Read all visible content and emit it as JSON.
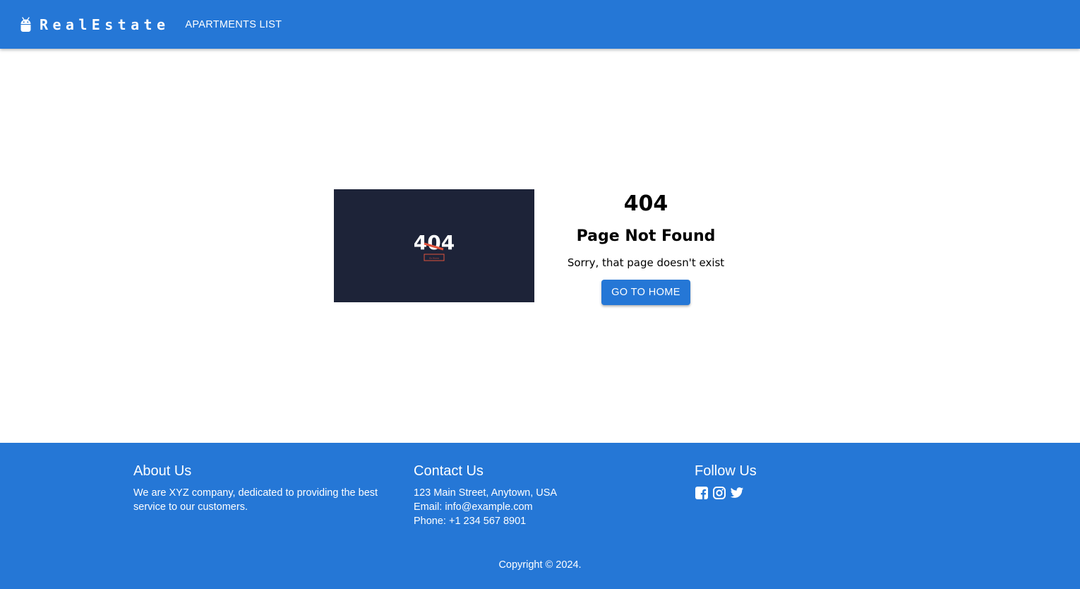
{
  "header": {
    "brand": "RealEstate",
    "logo_icon": "android-icon",
    "nav": [
      {
        "label": "APARTMENTS LIST"
      }
    ]
  },
  "hero_image": {
    "code": "404",
    "caption": "Go Home"
  },
  "error": {
    "code": "404",
    "title": "Page Not Found",
    "message": "Sorry, that page doesn't exist",
    "button_label": "GO TO HOME"
  },
  "footer": {
    "about": {
      "title": "About Us",
      "text": "We are XYZ company, dedicated to providing the best service to our customers."
    },
    "contact": {
      "title": "Contact Us",
      "address": "123 Main Street, Anytown, USA",
      "email": "Email: info@example.com",
      "phone": "Phone: +1 234 567 8901"
    },
    "follow": {
      "title": "Follow Us",
      "icons": [
        "facebook-icon",
        "instagram-icon",
        "twitter-icon"
      ]
    },
    "copyright": "Copyright © 2024."
  },
  "colors": {
    "primary": "#2577d6",
    "image_bg": "#1d2338",
    "accent": "#e0533d",
    "text": "#000000",
    "on_primary": "#ffffff"
  }
}
